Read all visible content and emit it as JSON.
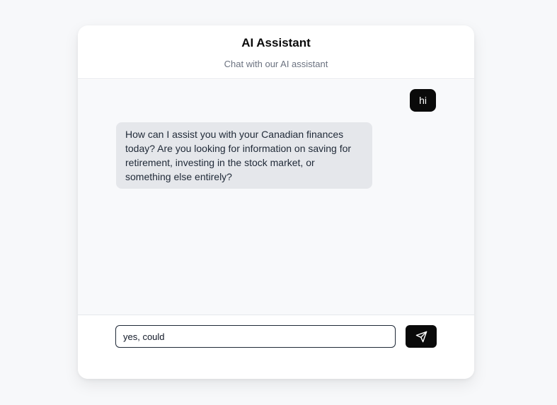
{
  "header": {
    "title": "AI Assistant",
    "subtitle": "Chat with our AI assistant"
  },
  "messages": [
    {
      "role": "user",
      "text": "hi"
    },
    {
      "role": "assistant",
      "text": "How can I assist you with your Canadian finances today? Are you looking for information on saving for retirement, investing in the stock market, or something else entirely?"
    }
  ],
  "composer": {
    "input_value": "yes, could",
    "send_icon": "send-icon"
  },
  "colors": {
    "page_background": "#f7f8fa",
    "user_bubble": "#0a0a0a",
    "assistant_bubble": "#e5e7eb",
    "send_button": "#0a0a0a"
  }
}
